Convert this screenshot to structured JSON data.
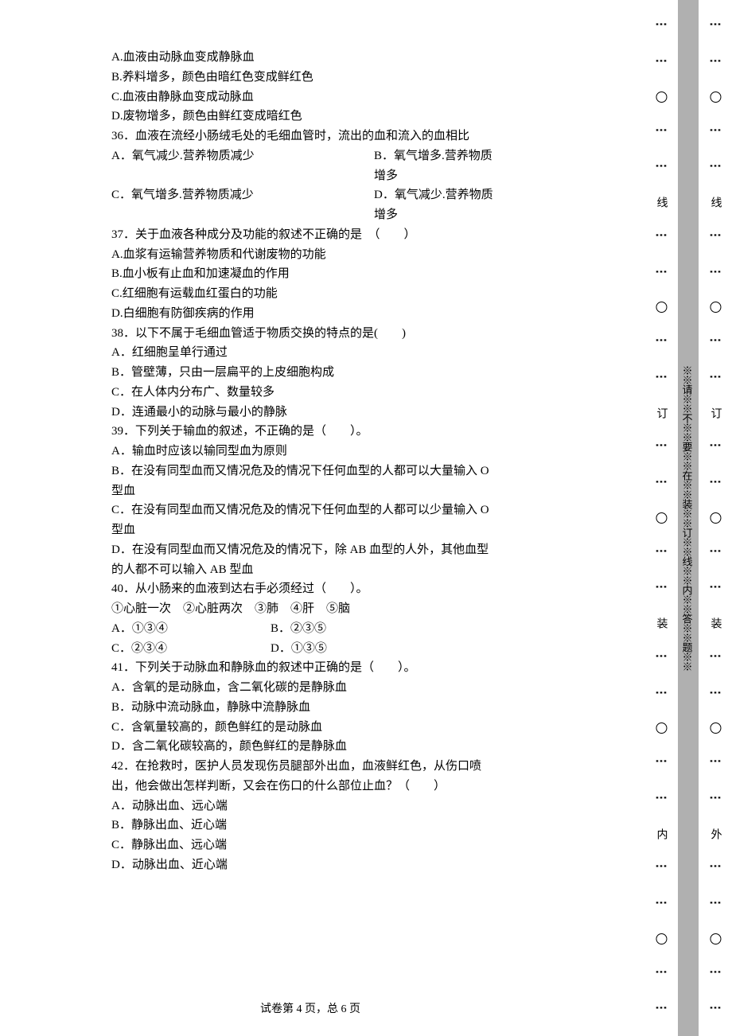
{
  "content": {
    "l01": "A.血液由动脉血变成静脉血",
    "l02": "B.养料增多，颜色由暗红色变成鲜红色",
    "l03": "C.血液由静脉血变成动脉血",
    "l04": "D.废物增多，颜色由鲜红变成暗红色",
    "q36": "36．血液在流经小肠绒毛处的毛细血管时，流出的血和流入的血相比",
    "q36a": "A．氧气减少.营养物质减少",
    "q36b": "B．氧气增多.营养物质增多",
    "q36c": "C．氧气增多.营养物质减少",
    "q36d": "D．氧气减少.营养物质增多",
    "q37": "37．关于血液各种成分及功能的叙述不正确的是　（　　）",
    "q37a": "A.血浆有运输营养物质和代谢废物的功能",
    "q37b": "B.血小板有止血和加速凝血的作用",
    "q37c": "C.红细胞有运载血红蛋白的功能",
    "q37d": "D.白细胞有防御疾病的作用",
    "q38": "38．以下不属于毛细血管适于物质交换的特点的是(　　)",
    "q38a": "A．红细胞呈单行通过",
    "q38b": "B．管壁薄，只由一层扁平的上皮细胞构成",
    "q38c": "C．在人体内分布广、数量较多",
    "q38d": "D．连通最小的动脉与最小的静脉",
    "q39": "39．下列关于输血的叙述，不正确的是（　　）。",
    "q39a": "A．输血时应该以输同型血为原则",
    "q39b": "B．在没有同型血而又情况危及的情况下任何血型的人都可以大量输入 O 型血",
    "q39c": "C．在没有同型血而又情况危及的情况下任何血型的人都可以少量输入 O 型血",
    "q39d": "D．在没有同型血而又情况危及的情况下，除 AB 血型的人外，其他血型的人都不可以输入 AB 型血",
    "q40": "40．从小肠来的血液到达右手必须经过（　　）。",
    "q40opts": "①心脏一次　②心脏两次　③肺　④肝　⑤脑",
    "q40a": "A．①③④",
    "q40b": "B．②③⑤",
    "q40c": "C．②③④",
    "q40d": "D．①③⑤",
    "q41": "41．下列关于动脉血和静脉血的叙述中正确的是（　　）。",
    "q41a": "A．含氧的是动脉血，含二氧化碳的是静脉血",
    "q41b": "B．动脉中流动脉血，静脉中流静脉血",
    "q41c": "C．含氧量较高的，颜色鲜红的是动脉血",
    "q41d": "D．含二氧化碳较高的，颜色鲜红的是静脉血",
    "q42": "42．在抢救时，医护人员发现伤员腿部外出血，血液鲜红色，从伤口喷出，他会做出怎样判断，又会在伤口的什么部位止血？（　　）",
    "q42a": "A．动脉出血、远心端",
    "q42b": "B．静脉出血、近心端",
    "q42c": "C．静脉出血、远心端",
    "q42d": "D．动脉出血、近心端"
  },
  "footer": "试卷第 4 页，总 6 页",
  "binding": {
    "inner_label": "内",
    "outer_label": "外",
    "zhuang": "装",
    "ding": "订",
    "xian": "线",
    "inner_text": "※※请※※不※※要※※在※※装※※订※※线※※内※※答※※题※※"
  }
}
